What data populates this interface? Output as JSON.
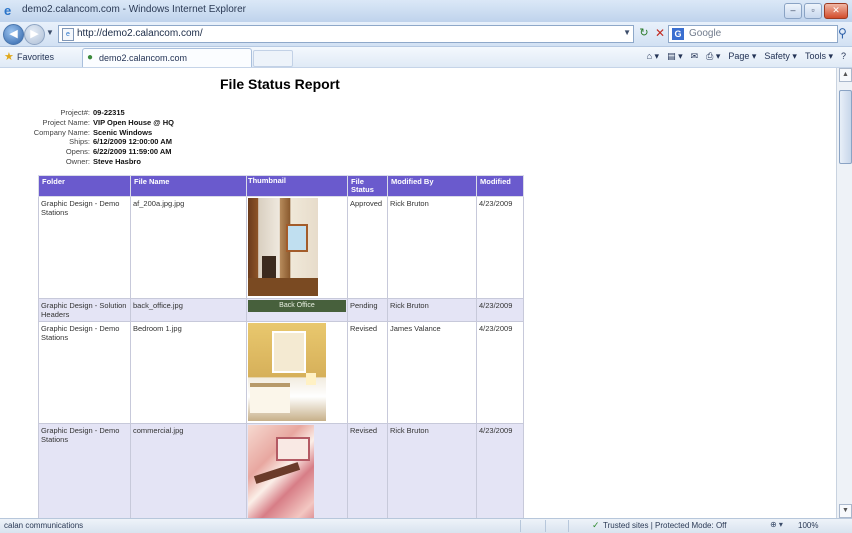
{
  "window": {
    "title": "demo2.calancom.com - Windows Internet Explorer",
    "controls": [
      "minimize-icon",
      "restore-icon",
      "close-icon"
    ]
  },
  "address_bar": {
    "url": "http://demo2.calancom.com/",
    "search_engine": "Google"
  },
  "favorites_bar": {
    "favorites_label": "Favorites",
    "tab_label": "demo2.calancom.com",
    "commands": [
      "Page ▾",
      "Safety ▾",
      "Tools ▾"
    ]
  },
  "report": {
    "title": "File Status Report",
    "meta": [
      {
        "label": "Project#:",
        "value": "09-22315"
      },
      {
        "label": "Project Name:",
        "value": "VIP Open House @ HQ"
      },
      {
        "label": "Company Name:",
        "value": "Scenic Windows"
      },
      {
        "label": "Ships:",
        "value": "6/12/2009 12:00:00 AM"
      },
      {
        "label": "Opens:",
        "value": "6/22/2009 11:59:00 AM"
      },
      {
        "label": "Owner:",
        "value": "Steve Hasbro"
      }
    ],
    "columns": [
      "Folder",
      "File Name",
      "Thumbnail",
      "File Status",
      "Modified By",
      "Modified"
    ],
    "rows": [
      {
        "folder": "Graphic Design - Demo Stations",
        "file": "af_200a.jpg.jpg",
        "status": "Approved",
        "modified_by": "Rick Bruton",
        "modified": "4/23/2009"
      },
      {
        "folder": "Graphic Design - Solution Headers",
        "file": "back_office.jpg",
        "thumbnail_text": "Back Office",
        "status": "Pending",
        "modified_by": "Rick Bruton",
        "modified": "4/23/2009"
      },
      {
        "folder": "Graphic Design - Demo Stations",
        "file": "Bedroom 1.jpg",
        "status": "Revised",
        "modified_by": "James Valance",
        "modified": "4/23/2009"
      },
      {
        "folder": "Graphic Design - Demo Stations",
        "file": "commercial.jpg",
        "status": "Revised",
        "modified_by": "Rick Bruton",
        "modified": "4/23/2009"
      }
    ]
  },
  "status_bar": {
    "left_text": "calan communications",
    "zone_text": "Trusted sites | Protected Mode: Off",
    "zoom": "100%"
  }
}
